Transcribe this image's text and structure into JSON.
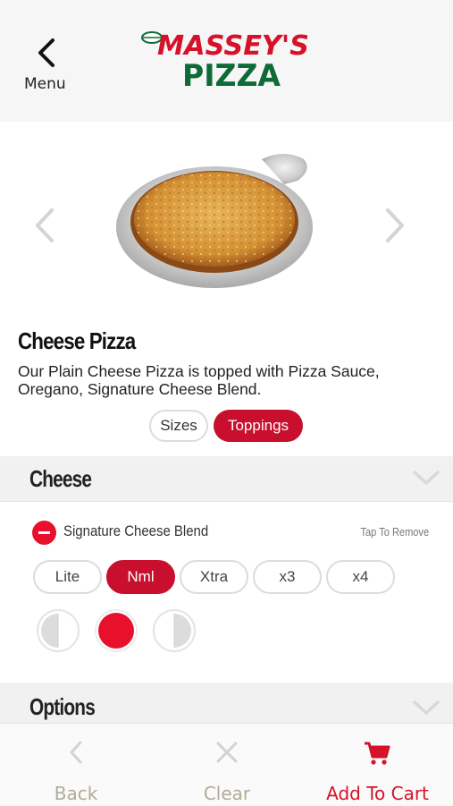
{
  "header": {
    "back_label": "Menu",
    "logo_line1": "MASSEY'S",
    "logo_line2": "PIZZA",
    "colors": {
      "logo_red": "#d6112a",
      "logo_green": "#0e6b38"
    }
  },
  "product": {
    "title": "Cheese Pizza",
    "description": "Our Plain Cheese Pizza is topped with Pizza Sauce, Oregano, Signature Cheese Blend."
  },
  "tabs": [
    {
      "label": "Sizes",
      "active": false
    },
    {
      "label": "Toppings",
      "active": true
    }
  ],
  "sections": {
    "cheese": {
      "title": "Cheese"
    },
    "options": {
      "title": "Options"
    }
  },
  "topping": {
    "name": "Signature Cheese Blend",
    "hint": "Tap To Remove",
    "amounts": [
      {
        "label": "Lite",
        "selected": false
      },
      {
        "label": "Nml",
        "selected": true
      },
      {
        "label": "Xtra",
        "selected": false
      },
      {
        "label": "x3",
        "selected": false
      },
      {
        "label": "x4",
        "selected": false
      }
    ],
    "placement_selected": "whole"
  },
  "bottom_bar": {
    "back": "Back",
    "clear": "Clear",
    "add_to_cart": "Add To Cart"
  },
  "colors": {
    "accent": "#c8102e",
    "inactive": "#b0ab98"
  }
}
